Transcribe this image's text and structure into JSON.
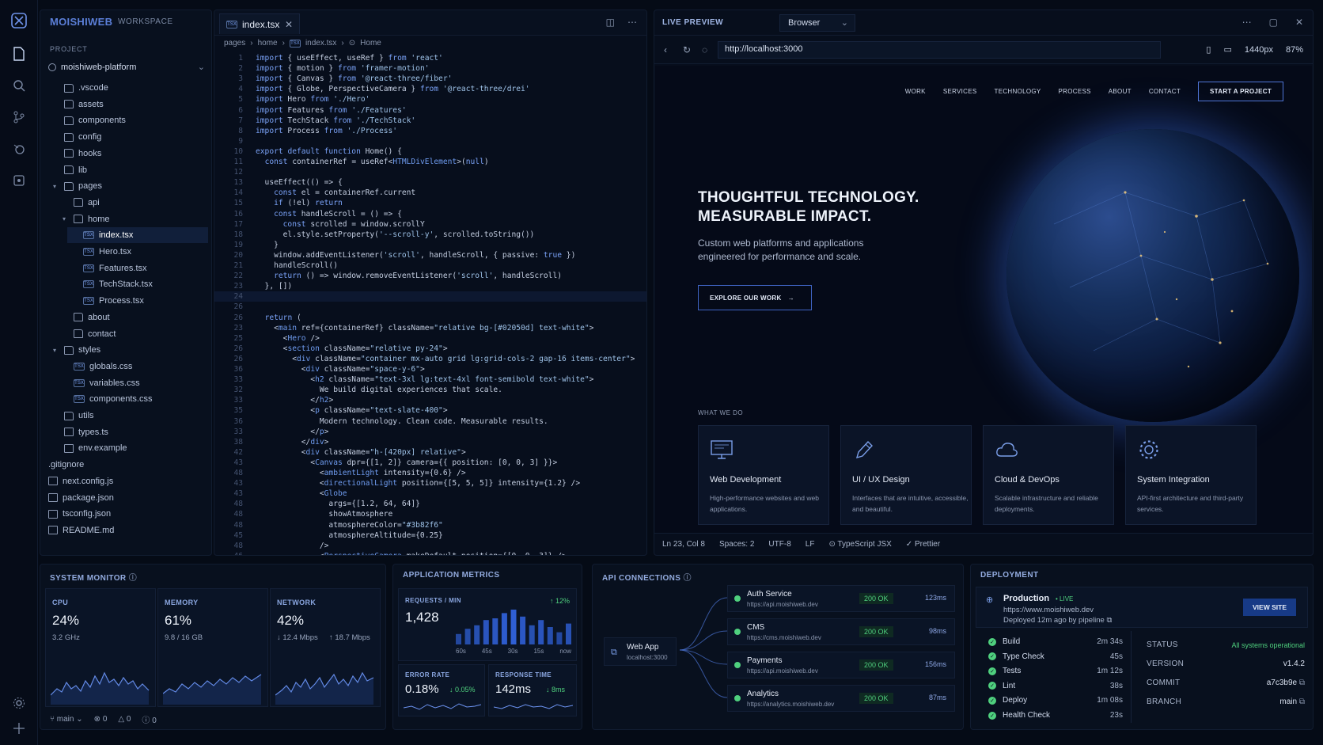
{
  "app": {
    "brand": "MOISHIWEB",
    "brand_sub": "WORKSPACE",
    "project_label": "PROJECT",
    "project_name": "moishiweb-platform"
  },
  "tree": [
    {
      "label": ".vscode",
      "type": "folder",
      "depth": 1
    },
    {
      "label": "assets",
      "type": "folder",
      "depth": 1
    },
    {
      "label": "components",
      "type": "folder",
      "depth": 1
    },
    {
      "label": "config",
      "type": "folder",
      "depth": 1
    },
    {
      "label": "hooks",
      "type": "folder",
      "depth": 1
    },
    {
      "label": "lib",
      "type": "folder",
      "depth": 1
    },
    {
      "label": "pages",
      "type": "folder-open",
      "depth": 1
    },
    {
      "label": "api",
      "type": "folder",
      "depth": 2
    },
    {
      "label": "home",
      "type": "folder-open",
      "depth": 2
    },
    {
      "label": "index.tsx",
      "type": "tsx",
      "depth": 3,
      "selected": true
    },
    {
      "label": "Hero.tsx",
      "type": "tsx",
      "depth": 3
    },
    {
      "label": "Features.tsx",
      "type": "tsx",
      "depth": 3
    },
    {
      "label": "TechStack.tsx",
      "type": "tsx",
      "depth": 3
    },
    {
      "label": "Process.tsx",
      "type": "tsx",
      "depth": 3
    },
    {
      "label": "about",
      "type": "folder",
      "depth": 2
    },
    {
      "label": "contact",
      "type": "folder",
      "depth": 2
    },
    {
      "label": "styles",
      "type": "folder-open",
      "depth": 1
    },
    {
      "label": "globals.css",
      "type": "tsx",
      "depth": 2
    },
    {
      "label": "variables.css",
      "type": "tsx",
      "depth": 2
    },
    {
      "label": "components.css",
      "type": "tsx",
      "depth": 2
    },
    {
      "label": "utils",
      "type": "folder",
      "depth": 1
    },
    {
      "label": "types.ts",
      "type": "file",
      "depth": 1
    },
    {
      "label": "env.example",
      "type": "file",
      "depth": 1
    },
    {
      "label": ".gitignore",
      "type": "plain",
      "depth": 0
    },
    {
      "label": "next.config.js",
      "type": "file",
      "depth": 0
    },
    {
      "label": "package.json",
      "type": "file",
      "depth": 0
    },
    {
      "label": "tsconfig.json",
      "type": "file",
      "depth": 0
    },
    {
      "label": "README.md",
      "type": "file",
      "depth": 0
    }
  ],
  "editor": {
    "tab_label": "index.tsx",
    "tab_badge": "TSX",
    "breadcrumb": [
      "pages",
      "home",
      "index.tsx",
      "Home"
    ],
    "current_line_index": 23,
    "lines": [
      {
        "n": "1",
        "t": "import { useEffect, useRef } from 'react'"
      },
      {
        "n": "2",
        "t": "import { motion } from 'framer-motion'"
      },
      {
        "n": "3",
        "t": "import { Canvas } from '@react-three/fiber'"
      },
      {
        "n": "4",
        "t": "import { Globe, PerspectiveCamera } from '@react-three/drei'"
      },
      {
        "n": "5",
        "t": "import Hero from './Hero'"
      },
      {
        "n": "6",
        "t": "import Features from './Features'"
      },
      {
        "n": "7",
        "t": "import TechStack from './TechStack'"
      },
      {
        "n": "8",
        "t": "import Process from './Process'"
      },
      {
        "n": "9",
        "t": ""
      },
      {
        "n": "10",
        "t": "export default function Home() {"
      },
      {
        "n": "11",
        "t": "  const containerRef = useRef<HTMLDivElement>(null)"
      },
      {
        "n": "12",
        "t": ""
      },
      {
        "n": "13",
        "t": "  useEffect(() => {"
      },
      {
        "n": "14",
        "t": "    const el = containerRef.current"
      },
      {
        "n": "15",
        "t": "    if (!el) return"
      },
      {
        "n": "16",
        "t": "    const handleScroll = () => {"
      },
      {
        "n": "17",
        "t": "      const scrolled = window.scrollY"
      },
      {
        "n": "18",
        "t": "      el.style.setProperty('--scroll-y', scrolled.toString())"
      },
      {
        "n": "19",
        "t": "    }"
      },
      {
        "n": "20",
        "t": "    window.addEventListener('scroll', handleScroll, { passive: true })"
      },
      {
        "n": "21",
        "t": "    handleScroll()"
      },
      {
        "n": "22",
        "t": "    return () => window.removeEventListener('scroll', handleScroll)"
      },
      {
        "n": "23",
        "t": "  }, [])"
      },
      {
        "n": "24",
        "t": ""
      },
      {
        "n": "26",
        "t": ""
      },
      {
        "n": "26",
        "t": "  return ("
      },
      {
        "n": "23",
        "t": "    <main ref={containerRef} className=\"relative bg-[#02050d] text-white\">"
      },
      {
        "n": "25",
        "t": "      <Hero />"
      },
      {
        "n": "26",
        "t": "      <section className=\"relative py-24\">"
      },
      {
        "n": "26",
        "t": "        <div className=\"container mx-auto grid lg:grid-cols-2 gap-16 items-center\">"
      },
      {
        "n": "36",
        "t": "          <div className=\"space-y-6\">"
      },
      {
        "n": "33",
        "t": "            <h2 className=\"text-3xl lg:text-4xl font-semibold text-white\">"
      },
      {
        "n": "32",
        "t": "              We build digital experiences that scale."
      },
      {
        "n": "33",
        "t": "            </h2>"
      },
      {
        "n": "35",
        "t": "            <p className=\"text-slate-400\">"
      },
      {
        "n": "36",
        "t": "              Modern technology. Clean code. Measurable results."
      },
      {
        "n": "33",
        "t": "            </p>"
      },
      {
        "n": "38",
        "t": "          </div>"
      },
      {
        "n": "42",
        "t": "          <div className=\"h-[420px] relative\">"
      },
      {
        "n": "43",
        "t": "            <Canvas dpr={[1, 2]} camera={{ position: [0, 0, 3] }}>"
      },
      {
        "n": "48",
        "t": "              <ambientLight intensity={0.6} />"
      },
      {
        "n": "43",
        "t": "              <directionalLight position={[5, 5, 5]} intensity={1.2} />"
      },
      {
        "n": "43",
        "t": "              <Globe"
      },
      {
        "n": "48",
        "t": "                args={[1.2, 64, 64]}"
      },
      {
        "n": "48",
        "t": "                showAtmosphere"
      },
      {
        "n": "48",
        "t": "                atmosphereColor=\"#3b82f6\""
      },
      {
        "n": "45",
        "t": "                atmosphereAltitude={0.25}"
      },
      {
        "n": "48",
        "t": "              />"
      },
      {
        "n": "46",
        "t": "              <PerspectiveCamera makeDefault position={[0, 0, 3]} />"
      }
    ]
  },
  "preview": {
    "title": "LIVE PREVIEW",
    "browser_select": "Browser",
    "url": "http://localhost:3000",
    "viewport": "1440px",
    "zoom": "87%",
    "nav": [
      "WORK",
      "SERVICES",
      "TECHNOLOGY",
      "PROCESS",
      "ABOUT",
      "CONTACT"
    ],
    "cta": "START A PROJECT",
    "hero_line1": "THOUGHTFUL TECHNOLOGY.",
    "hero_line2": "MEASURABLE IMPACT.",
    "hero_sub": "Custom web platforms and applications engineered for performance and scale.",
    "hero_button": "EXPLORE OUR WORK",
    "what_we_do": "WHAT WE DO",
    "services": [
      {
        "name": "Web Development",
        "desc": "High-performance websites and web applications.",
        "icon": "monitor-icon"
      },
      {
        "name": "UI / UX Design",
        "desc": "Interfaces that are intuitive, accessible, and beautiful.",
        "icon": "pen-icon"
      },
      {
        "name": "Cloud & DevOps",
        "desc": "Scalable infrastructure and reliable deployments.",
        "icon": "cloud-icon"
      },
      {
        "name": "System Integration",
        "desc": "API-first architecture and third-party services.",
        "icon": "gear-icon"
      }
    ],
    "status": [
      "Ln 23, Col 8",
      "Spaces: 2",
      "UTF-8",
      "LF",
      "TypeScript JSX",
      "Prettier"
    ]
  },
  "system_monitor": {
    "title": "SYSTEM MONITOR",
    "cpu": {
      "label": "CPU",
      "value": "24%",
      "sub": "3.2 GHz"
    },
    "memory": {
      "label": "MEMORY",
      "value": "61%",
      "sub": "9.8 / 16 GB"
    },
    "network": {
      "label": "NETWORK",
      "value": "42%",
      "down": "↓ 12.4 Mbps",
      "up": "↑ 18.7 Mbps"
    },
    "footer": {
      "branch": "main",
      "errors": "0",
      "warnings": "0",
      "info": "0"
    }
  },
  "app_metrics": {
    "title": "APPLICATION METRICS",
    "requests_label": "REQUESTS / MIN",
    "requests_value": "1,428",
    "requests_delta": "↑ 12%",
    "bar_axis": [
      "60s",
      "45s",
      "30s",
      "15s",
      "now"
    ],
    "bars": [
      0.3,
      0.45,
      0.55,
      0.7,
      0.75,
      0.9,
      1.0,
      0.8,
      0.55,
      0.7,
      0.5,
      0.35,
      0.6
    ],
    "error_label": "ERROR RATE",
    "error_value": "0.18%",
    "error_delta": "↓ 0.05%",
    "response_label": "RESPONSE TIME",
    "response_value": "142ms",
    "response_delta": "↓ 8ms"
  },
  "api": {
    "title": "API CONNECTIONS",
    "source": {
      "name": "Web App",
      "host": "localhost:3000"
    },
    "services": [
      {
        "name": "Auth Service",
        "url": "https://api.moishiweb.dev",
        "status": "200 OK",
        "ms": "123ms"
      },
      {
        "name": "CMS",
        "url": "https://cms.moishiweb.dev",
        "status": "200 OK",
        "ms": "98ms"
      },
      {
        "name": "Payments",
        "url": "https://api.moishiweb.dev",
        "status": "200 OK",
        "ms": "156ms"
      },
      {
        "name": "Analytics",
        "url": "https://analytics.moishiweb.dev",
        "status": "200 OK",
        "ms": "87ms"
      }
    ]
  },
  "deployment": {
    "title": "DEPLOYMENT",
    "env": "Production",
    "live": "• LIVE",
    "url": "https://www.moishiweb.dev",
    "deployed": "Deployed 12m ago by pipeline",
    "view_site": "VIEW SITE",
    "steps": [
      {
        "name": "Build",
        "time": "2m 34s"
      },
      {
        "name": "Type Check",
        "time": "45s"
      },
      {
        "name": "Tests",
        "time": "1m 12s"
      },
      {
        "name": "Lint",
        "time": "38s"
      },
      {
        "name": "Deploy",
        "time": "1m 08s"
      },
      {
        "name": "Health Check",
        "time": "23s"
      }
    ],
    "info": [
      {
        "k": "STATUS",
        "v": "All systems operational"
      },
      {
        "k": "VERSION",
        "v": "v1.4.2"
      },
      {
        "k": "COMMIT",
        "v": "a7c3b9e"
      },
      {
        "k": "BRANCH",
        "v": "main"
      }
    ]
  },
  "colors": {
    "accent": "#4f75d6",
    "success": "#4fd07e",
    "bg": "#050b16"
  }
}
